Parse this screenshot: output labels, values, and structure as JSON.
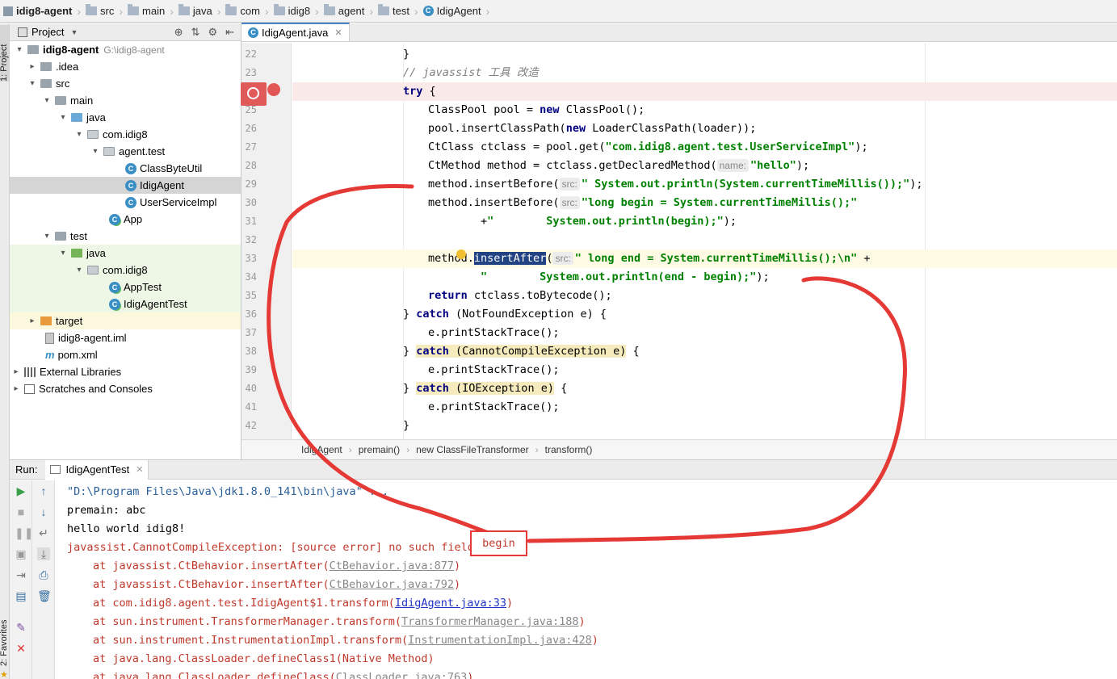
{
  "navbar": {
    "crumbs": [
      "idig8-agent",
      "src",
      "main",
      "java",
      "com",
      "idig8",
      "agent",
      "test",
      "IdigAgent"
    ]
  },
  "sidestrip": {
    "project_tab": "1: Project",
    "favorites_tab": "2: Favorites"
  },
  "project": {
    "header": "Project",
    "root": {
      "label": "idig8-agent",
      "path": "G:\\idig8-agent"
    },
    "items": [
      ".idea",
      "src",
      "main",
      "java",
      "com.idig8",
      "agent.test",
      "ClassByteUtil",
      "IdigAgent",
      "UserServiceImpl",
      "App",
      "test",
      "java",
      "com.idig8",
      "AppTest",
      "IdigAgentTest",
      "target",
      "idig8-agent.iml",
      "pom.xml",
      "External Libraries",
      "Scratches and Consoles"
    ]
  },
  "editor": {
    "tab": "IdigAgent.java",
    "line_numbers": [
      "22",
      "23",
      "24",
      "25",
      "26",
      "27",
      "28",
      "29",
      "30",
      "31",
      "32",
      "33",
      "34",
      "35",
      "36",
      "37",
      "38",
      "39",
      "40",
      "41",
      "42"
    ],
    "code": {
      "l22": "}",
      "l23": "// javassist 工具 改造",
      "l24_kw": "try",
      "l24": " {",
      "l25a": "ClassPool pool = ",
      "l25kw": "new",
      "l25b": " ClassPool();",
      "l26a": "pool.insertClassPath(",
      "l26kw": "new",
      "l26b": " LoaderClassPath(loader));",
      "l27a": "CtClass ctclass = pool.get(",
      "l27s": "\"com.idig8.agent.test.UserServiceImpl\"",
      "l27b": ");",
      "l28a": "CtMethod method = ctclass.getDeclaredMethod(",
      "l28hint": "name:",
      "l28s": "\"hello\"",
      "l28b": ");",
      "l29a": "method.insertBefore(",
      "l29hint": "src:",
      "l29s": "\" System.out.println(System.currentTimeMillis());\"",
      "l29b": ");",
      "l30a": "method.insertBefore(",
      "l30hint": "src:",
      "l30s": "\"long begin = System.currentTimeMillis();\"",
      "l31a": "+",
      "l31s": "\"        System.out.println(begin);\"",
      "l31b": ");",
      "l33a": "method.",
      "l33sel": "insertAfter",
      "l33b": "(",
      "l33hint": "src:",
      "l33s": "\" long end = System.currentTimeMillis();\\n\"",
      "l33c": " +",
      "l34s": "\"        System.out.println(end - begin);\"",
      "l34b": ");",
      "l35kw": "return",
      "l35": " ctclass.toBytecode();",
      "l36a": "} ",
      "l36kw": "catch",
      "l36b": " (NotFoundException e) {",
      "l37": "e.printStackTrace();",
      "l38a": "} ",
      "l38kw": "catch",
      "l38hl": " (CannotCompileException e)",
      "l38b": " {",
      "l39": "e.printStackTrace();",
      "l40a": "} ",
      "l40kw": "catch",
      "l40hl": " (IOException e)",
      "l40b": " {",
      "l41": "e.printStackTrace();",
      "l42": "}"
    },
    "breadcrumb": [
      "IdigAgent",
      "premain()",
      "new ClassFileTransformer",
      "transform()"
    ]
  },
  "run": {
    "label": "Run:",
    "tab": "IdigAgentTest",
    "output": {
      "cmd": "\"D:\\Program Files\\Java\\jdk1.8.0_141\\bin\\java\" ...",
      "o1": "premain: abc",
      "o2": "hello world idig8!",
      "o3": "javassist.CannotCompileException: [source error] no such field ",
      "o3_boxed": "begin",
      "t1a": "at javassist.CtBehavior.insertAfter(",
      "t1l": "CtBehavior.java:877",
      "t1b": ")",
      "t2a": "at javassist.CtBehavior.insertAfter(",
      "t2l": "CtBehavior.java:792",
      "t2b": ")",
      "t3a": "at com.idig8.agent.test.IdigAgent$1.transform(",
      "t3l": "IdigAgent.java:33",
      "t3b": ")",
      "t4a": "at sun.instrument.TransformerManager.transform(",
      "t4l": "TransformerManager.java:188",
      "t4b": ")",
      "t5a": "at sun.instrument.InstrumentationImpl.transform(",
      "t5l": "InstrumentationImpl.java:428",
      "t5b": ")",
      "t6": "at java.lang.ClassLoader.defineClass1(Native Method)",
      "t7a": "at java.lang.ClassLoader.defineClass(",
      "t7l": "ClassLoader.java:763",
      "t7b": ")"
    }
  },
  "colors": {
    "annotation": "#e53935",
    "keyword": "#000080",
    "string": "#008000",
    "error": "#c0392b"
  }
}
